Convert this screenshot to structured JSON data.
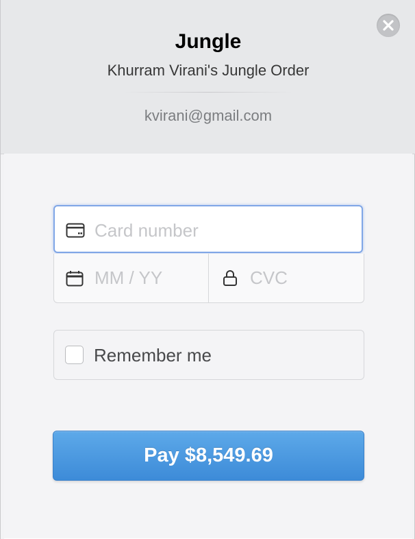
{
  "header": {
    "title": "Jungle",
    "subtitle": "Khurram Virani's Jungle Order",
    "email": "kvirani@gmail.com"
  },
  "form": {
    "card_number": {
      "placeholder": "Card number",
      "value": ""
    },
    "expiry": {
      "placeholder": "MM / YY",
      "value": ""
    },
    "cvc": {
      "placeholder": "CVC",
      "value": ""
    },
    "remember": {
      "label": "Remember me",
      "checked": false
    }
  },
  "pay_button": {
    "label": "Pay $8,549.69"
  },
  "icons": {
    "close": "close-icon",
    "card": "credit-card-icon",
    "calendar": "calendar-icon",
    "lock": "lock-icon"
  },
  "colors": {
    "accent": "#4a98e0",
    "focus_border": "#7fa6e6",
    "header_bg": "#e7e8ea",
    "panel_bg": "#f4f4f6"
  }
}
